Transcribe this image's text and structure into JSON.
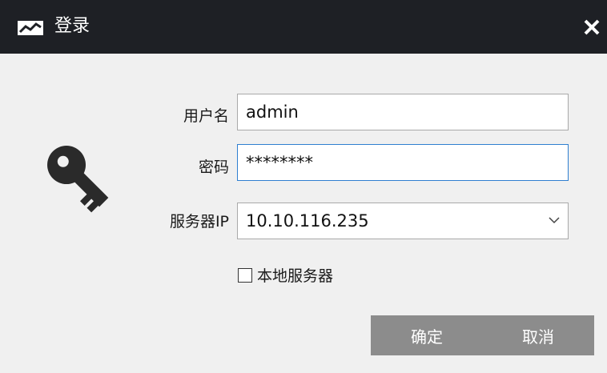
{
  "window": {
    "title": "登录",
    "title_bar_color": "#1e2025",
    "icons": {
      "app": "chart-logo-icon",
      "close": "close-icon"
    }
  },
  "form": {
    "key_icon": "key-icon",
    "username": {
      "label": "用户名",
      "value": "admin"
    },
    "password": {
      "label": "密码",
      "value": "********"
    },
    "server_ip": {
      "label": "服务器IP",
      "value": "10.10.116.235"
    },
    "local_server": {
      "label": "本地服务器",
      "checked": false
    }
  },
  "buttons": {
    "confirm": "确定",
    "cancel": "取消",
    "color": "#8c8c8c"
  }
}
